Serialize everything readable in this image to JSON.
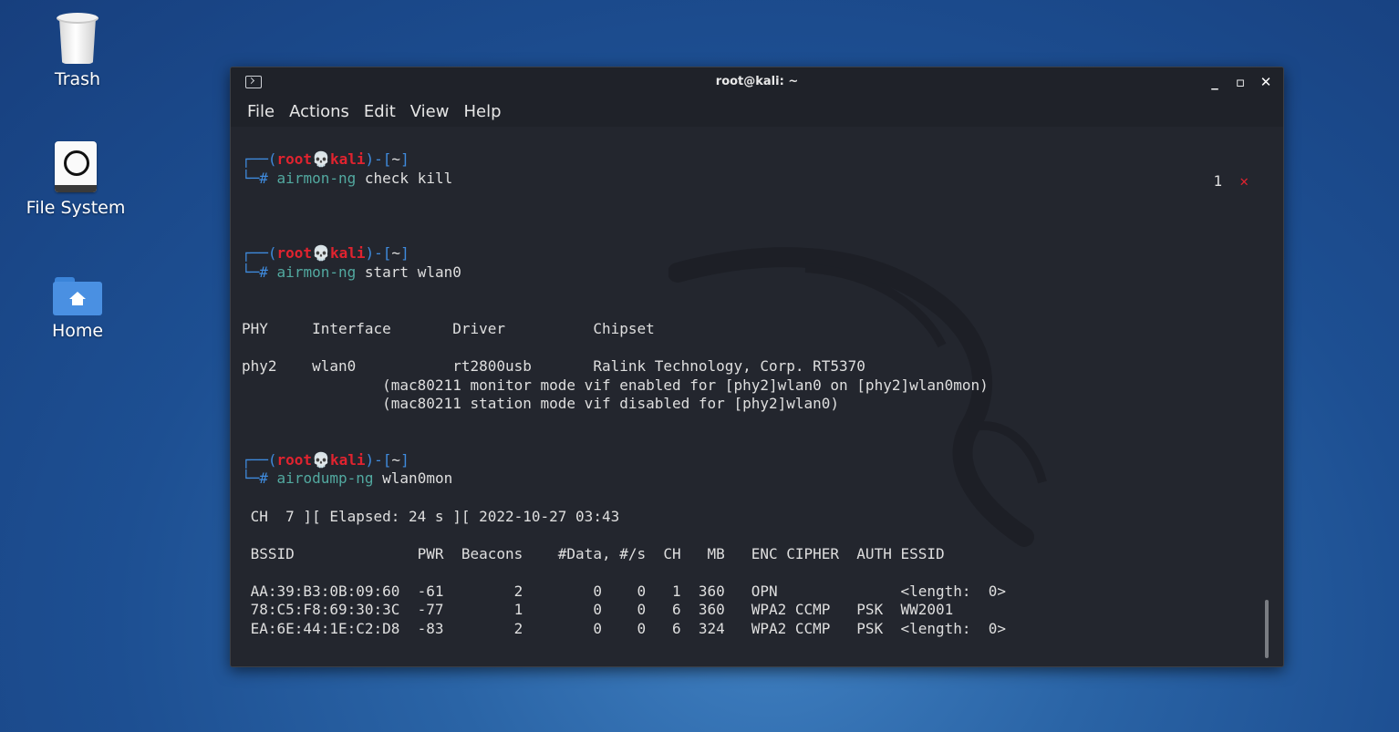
{
  "desktop": {
    "icons": [
      {
        "label": "Trash",
        "icon": "trash-icon"
      },
      {
        "label": "File System",
        "icon": "drive-icon"
      },
      {
        "label": "Home",
        "icon": "home-folder-icon"
      }
    ]
  },
  "window": {
    "title": "root@kali: ~",
    "menu": [
      "File",
      "Actions",
      "Edit",
      "View",
      "Help"
    ],
    "controls": {
      "minimize": "_",
      "maximize": "▫",
      "close": "✕"
    }
  },
  "terminal": {
    "prompt": {
      "open": "┌──(",
      "user": "root",
      "skull": "💀",
      "host": "kali",
      "close": ")-[",
      "dir": "~",
      "end": "]",
      "hash": "└─#"
    },
    "cmd1": {
      "tool": "airmon-ng",
      "args": "check kill"
    },
    "error_badge": {
      "code": "1",
      "mark": "✕"
    },
    "cmd2": {
      "tool": "airmon-ng",
      "args": "start wlan0"
    },
    "airmon_header": "PHY     Interface       Driver          Chipset",
    "airmon_row": "phy2    wlan0           rt2800usb       Ralink Technology, Corp. RT5370",
    "airmon_note1": "                (mac80211 monitor mode vif enabled for [phy2]wlan0 on [phy2]wlan0mon)",
    "airmon_note2": "                (mac80211 station mode vif disabled for [phy2]wlan0)",
    "cmd3": {
      "tool": "airodump-ng",
      "args": "wlan0mon"
    },
    "dump_status": " CH  7 ][ Elapsed: 24 s ][ 2022-10-27 03:43",
    "dump_header": " BSSID              PWR  Beacons    #Data, #/s  CH   MB   ENC CIPHER  AUTH ESSID",
    "dump_rows": [
      " AA:39:B3:0B:09:60  -61        2        0    0   1  360   OPN              <length:  0>",
      " 78:C5:F8:69:30:3C  -77        1        0    0   6  360   WPA2 CCMP   PSK  WW2001",
      " EA:6E:44:1E:C2:D8  -83        2        0    0   6  324   WPA2 CCMP   PSK  <length:  0>"
    ]
  }
}
